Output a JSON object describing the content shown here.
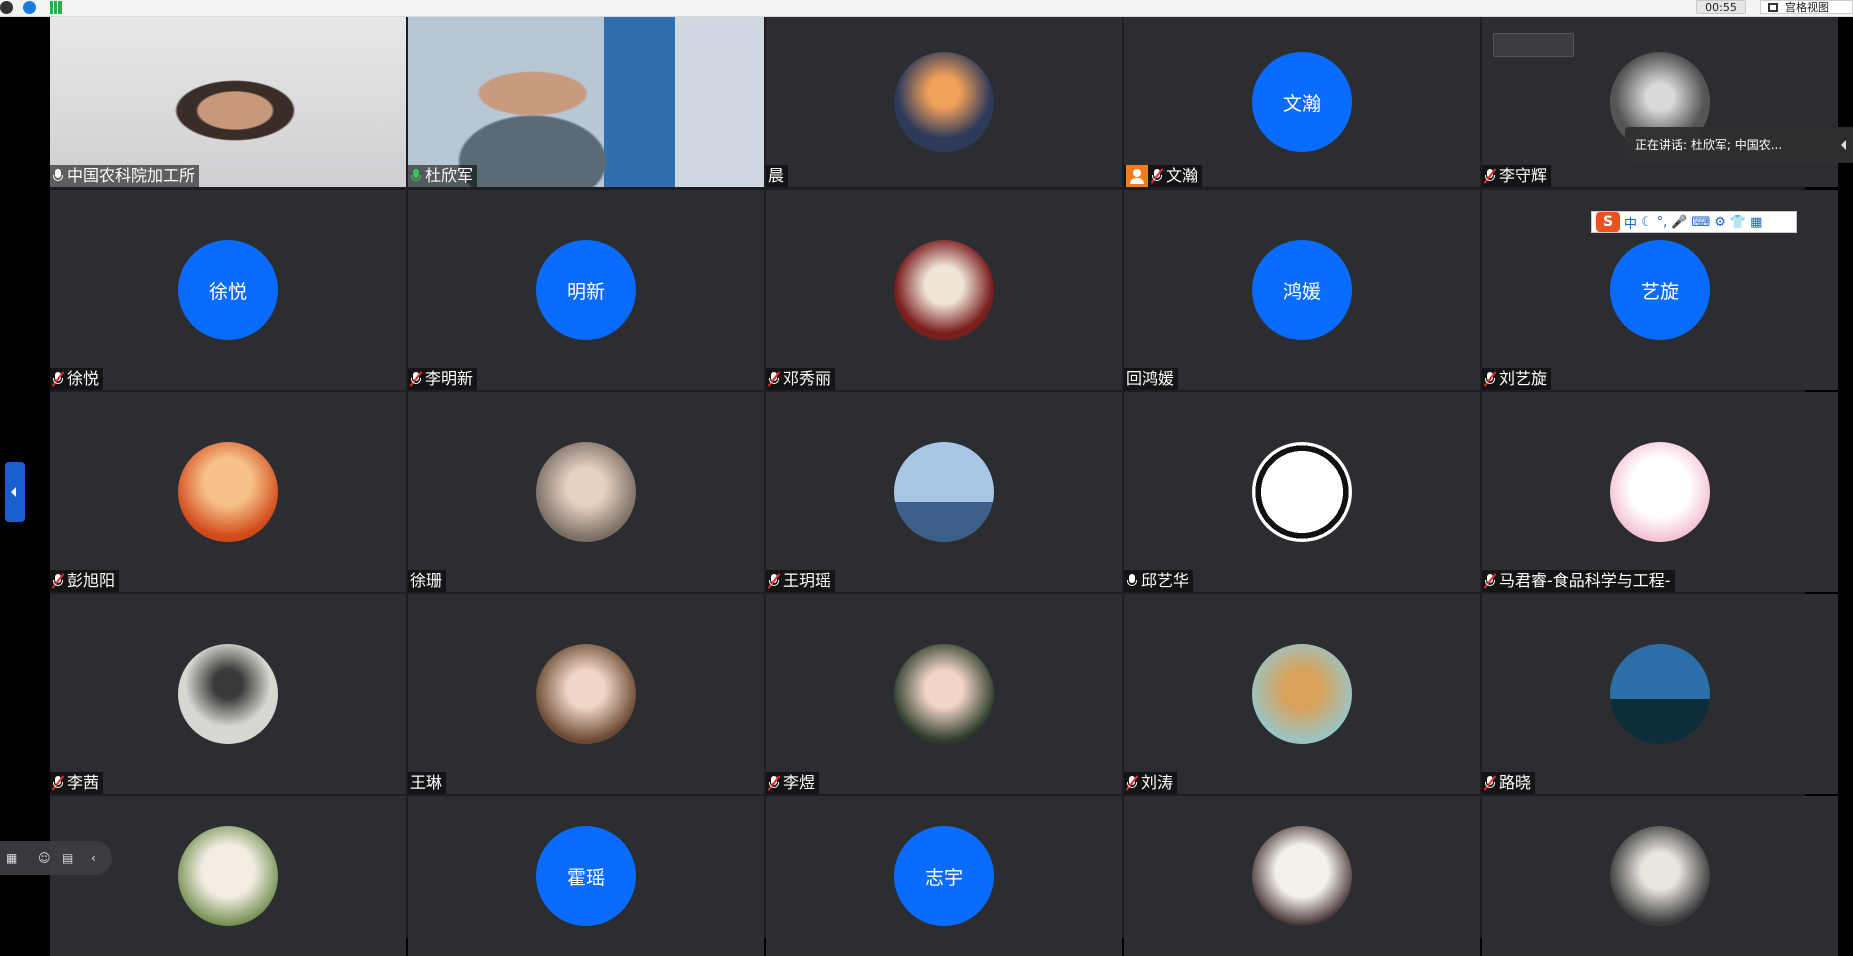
{
  "topbar": {
    "timer": "00:55",
    "view_button_label": "宫格视图"
  },
  "speaking_banner": {
    "text": "正在讲话: 杜欣军; 中国农..."
  },
  "ime": {
    "logo": "S",
    "items": [
      "中",
      "☾",
      "°,",
      "🎤",
      "⌨",
      "⚙",
      "👕",
      "▦"
    ]
  },
  "participants": [
    {
      "name": "中国农科院加工所",
      "mic": "on-white",
      "type": "video",
      "active": false
    },
    {
      "name": "杜欣军",
      "mic": "on",
      "type": "video",
      "active": true
    },
    {
      "name": "晨",
      "mic": "none",
      "type": "photo"
    },
    {
      "name": "文瀚",
      "mic": "muted",
      "type": "text",
      "avatar_text": "文瀚",
      "host": true
    },
    {
      "name": "李守辉",
      "mic": "muted",
      "type": "photo"
    },
    {
      "name": "徐悦",
      "mic": "muted",
      "type": "text",
      "avatar_text": "徐悦"
    },
    {
      "name": "李明新",
      "mic": "muted",
      "type": "text",
      "avatar_text": "明新"
    },
    {
      "name": "邓秀丽",
      "mic": "muted",
      "type": "photo"
    },
    {
      "name": "回鸿媛",
      "mic": "none",
      "type": "text",
      "avatar_text": "鸿媛"
    },
    {
      "name": "刘艺旋",
      "mic": "muted",
      "type": "text",
      "avatar_text": "艺旋"
    },
    {
      "name": "彭旭阳",
      "mic": "muted",
      "type": "photo"
    },
    {
      "name": "徐珊",
      "mic": "none",
      "type": "photo"
    },
    {
      "name": "王玥瑶",
      "mic": "muted",
      "type": "photo"
    },
    {
      "name": "邱艺华",
      "mic": "on-white",
      "type": "photo"
    },
    {
      "name": "马君睿-食品科学与工程-",
      "mic": "muted",
      "type": "photo"
    },
    {
      "name": "李茜",
      "mic": "muted",
      "type": "photo"
    },
    {
      "name": "王琳",
      "mic": "none",
      "type": "photo"
    },
    {
      "name": "李煜",
      "mic": "muted",
      "type": "photo"
    },
    {
      "name": "刘涛",
      "mic": "muted",
      "type": "photo"
    },
    {
      "name": "路晓",
      "mic": "muted",
      "type": "photo"
    },
    {
      "name": "",
      "mic": "none",
      "type": "photo"
    },
    {
      "name": "",
      "mic": "none",
      "type": "text",
      "avatar_text": "霍瑶"
    },
    {
      "name": "",
      "mic": "none",
      "type": "text",
      "avatar_text": "志宇"
    },
    {
      "name": "",
      "mic": "none",
      "type": "photo"
    },
    {
      "name": "",
      "mic": "none",
      "type": "photo"
    }
  ],
  "colors": {
    "accent": "#0a6cff",
    "tile_bg": "#2b2d30",
    "active_border": "#3cc45a",
    "host_badge": "#f07c1e"
  }
}
